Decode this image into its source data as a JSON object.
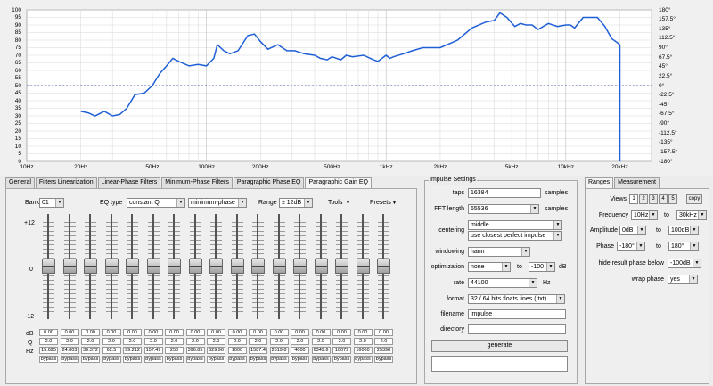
{
  "graph": {
    "yLeft": [
      "100",
      "95",
      "90",
      "85",
      "80",
      "75",
      "70",
      "65",
      "60",
      "55",
      "50",
      "45",
      "40",
      "35",
      "30",
      "25",
      "20",
      "15",
      "10",
      "5",
      "0"
    ],
    "yRight": [
      "180°",
      "157.5°",
      "135°",
      "112.5°",
      "90°",
      "67.5°",
      "45°",
      "22.5°",
      "0°",
      "-22.5°",
      "-45°",
      "-67.5°",
      "-90°",
      "-112.5°",
      "-135°",
      "-157.5°",
      "-180°"
    ],
    "xTicks": [
      {
        "label": "10Hz",
        "f": 10
      },
      {
        "label": "20Hz",
        "f": 20
      },
      {
        "label": "50Hz",
        "f": 50
      },
      {
        "label": "100Hz",
        "f": 100
      },
      {
        "label": "200Hz",
        "f": 200
      },
      {
        "label": "500Hz",
        "f": 500
      },
      {
        "label": "1kHz",
        "f": 1000
      },
      {
        "label": "2kHz",
        "f": 2000
      },
      {
        "label": "5kHz",
        "f": 5000
      },
      {
        "label": "10kHz",
        "f": 10000
      },
      {
        "label": "20kHz",
        "f": 20000
      }
    ],
    "fMin": 10,
    "fMax": 30000,
    "ampMin": 0,
    "ampMax": 100,
    "curveColor": "#1f5fd6",
    "curve": [
      [
        20,
        33
      ],
      [
        22,
        32
      ],
      [
        24,
        30
      ],
      [
        27,
        33
      ],
      [
        30,
        30
      ],
      [
        33,
        31
      ],
      [
        36,
        35
      ],
      [
        40,
        44
      ],
      [
        45,
        45
      ],
      [
        50,
        50
      ],
      [
        55,
        58
      ],
      [
        60,
        63
      ],
      [
        65,
        68
      ],
      [
        70,
        66
      ],
      [
        80,
        63
      ],
      [
        90,
        64
      ],
      [
        100,
        63
      ],
      [
        110,
        68
      ],
      [
        115,
        77
      ],
      [
        125,
        73
      ],
      [
        135,
        71
      ],
      [
        150,
        73
      ],
      [
        170,
        83
      ],
      [
        185,
        84
      ],
      [
        200,
        79
      ],
      [
        220,
        74
      ],
      [
        250,
        77
      ],
      [
        280,
        73
      ],
      [
        310,
        73
      ],
      [
        350,
        71
      ],
      [
        400,
        70
      ],
      [
        430,
        68
      ],
      [
        470,
        67
      ],
      [
        500,
        69
      ],
      [
        560,
        67
      ],
      [
        600,
        70
      ],
      [
        650,
        69
      ],
      [
        750,
        70
      ],
      [
        850,
        67
      ],
      [
        900,
        66
      ],
      [
        950,
        68
      ],
      [
        1000,
        70
      ],
      [
        1050,
        68
      ],
      [
        1100,
        69
      ],
      [
        1250,
        71
      ],
      [
        1400,
        73
      ],
      [
        1600,
        75
      ],
      [
        2000,
        75
      ],
      [
        2500,
        80
      ],
      [
        3000,
        88
      ],
      [
        3600,
        92
      ],
      [
        4000,
        93
      ],
      [
        4300,
        98
      ],
      [
        4700,
        95
      ],
      [
        5200,
        89
      ],
      [
        5600,
        91
      ],
      [
        6000,
        90
      ],
      [
        6500,
        90
      ],
      [
        7000,
        87
      ],
      [
        8000,
        91
      ],
      [
        9000,
        89
      ],
      [
        10000,
        90
      ],
      [
        10600,
        90
      ],
      [
        11200,
        88
      ],
      [
        12500,
        95
      ],
      [
        13500,
        95
      ],
      [
        15000,
        95
      ],
      [
        16500,
        89
      ],
      [
        18000,
        81
      ],
      [
        19500,
        78
      ],
      [
        20000,
        77
      ],
      [
        20000,
        0
      ]
    ]
  },
  "leftTabs": [
    "General",
    "Filters Linearization",
    "Linear-Phase Filters",
    "Minimum-Phase Filters",
    "Paragraphic Phase EQ",
    "Paragraphic Gain EQ"
  ],
  "eq": {
    "bankLabel": "Bank",
    "bankValue": "01",
    "eqTypeLabel": "EQ type",
    "eqTypeValue": "constant Q",
    "eqPhaseValue": "minimum-phase",
    "rangeLabel": "Range",
    "rangeValue": "± 12dB",
    "toolsLabel": "Tools",
    "presetsLabel": "Presets",
    "scaleTop": "+12",
    "scaleMid": "0",
    "scaleBot": "-12",
    "rowDb": "dB",
    "rowQ": "Q",
    "rowHz": "Hz",
    "bands": [
      {
        "db": "0.00",
        "q": "2.0",
        "hz": "15.625",
        "mode": "bypass"
      },
      {
        "db": "0.00",
        "q": "2.0",
        "hz": "24.803",
        "mode": "bypass"
      },
      {
        "db": "0.00",
        "q": "2.0",
        "hz": "39.372",
        "mode": "bypass"
      },
      {
        "db": "0.00",
        "q": "2.0",
        "hz": "62.5",
        "mode": "bypass"
      },
      {
        "db": "0.00",
        "q": "2.0",
        "hz": "99.212",
        "mode": "bypass"
      },
      {
        "db": "0.00",
        "q": "2.0",
        "hz": "157.49",
        "mode": "bypass"
      },
      {
        "db": "0.00",
        "q": "2.0",
        "hz": "250",
        "mode": "bypass"
      },
      {
        "db": "0.00",
        "q": "2.0",
        "hz": "396.85",
        "mode": "bypass"
      },
      {
        "db": "0.00",
        "q": "2.0",
        "hz": "629.96",
        "mode": "bypass"
      },
      {
        "db": "0.00",
        "q": "2.0",
        "hz": "1000",
        "mode": "bypass"
      },
      {
        "db": "0.00",
        "q": "2.0",
        "hz": "1587.4",
        "mode": "bypass"
      },
      {
        "db": "0.00",
        "q": "2.0",
        "hz": "2519.8",
        "mode": "bypass"
      },
      {
        "db": "0.00",
        "q": "2.0",
        "hz": "4000",
        "mode": "bypass"
      },
      {
        "db": "0.00",
        "q": "2.0",
        "hz": "6349.6",
        "mode": "bypass"
      },
      {
        "db": "0.00",
        "q": "2.0",
        "hz": "10079",
        "mode": "bypass"
      },
      {
        "db": "0.00",
        "q": "2.0",
        "hz": "16000",
        "mode": "bypass"
      },
      {
        "db": "0.00",
        "q": "2.0",
        "hz": "25398",
        "mode": "bypass"
      }
    ]
  },
  "impulse": {
    "title": "Impulse Settings",
    "tapsLabel": "taps",
    "tapsValue": "16384",
    "tapsUnit": "samples",
    "fftLabel": "FFT length",
    "fftValue": "65536",
    "fftUnit": "samples",
    "centeringLabel": "centering",
    "centeringValue": "middle",
    "centeringValue2": "use closest perfect impulse",
    "windowingLabel": "windowing",
    "windowingValue": "hann",
    "optLabel": "optimization",
    "optValue": "none",
    "optTo": "to",
    "optDb": "-100",
    "optUnit": "dB",
    "rateLabel": "rate",
    "rateValue": "44100",
    "rateUnit": "Hz",
    "formatLabel": "format",
    "formatValue": "32 / 64 bits floats lines ( txt)",
    "filenameLabel": "filename",
    "filenameValue": "impulse",
    "directoryLabel": "directory",
    "directoryValue": "",
    "generate": "generate"
  },
  "rightTabs": [
    "Ranges",
    "Measurement"
  ],
  "ranges": {
    "viewsLabel": "Views",
    "views": [
      "1",
      "2",
      "3",
      "4",
      "5"
    ],
    "copy": "copy",
    "freqLabel": "Frequency",
    "freqFrom": "10Hz",
    "freqTo": "30kHz",
    "to": "to",
    "ampLabel": "Amplitude",
    "ampFrom": "0dB",
    "ampTo": "100dB",
    "phaseLabel": "Phase",
    "phaseFrom": "-180°",
    "phaseTo": "180°",
    "hideLabel": "hide result phase below",
    "hideValue": "-100dB",
    "wrapLabel": "wrap phase",
    "wrapValue": "yes"
  }
}
